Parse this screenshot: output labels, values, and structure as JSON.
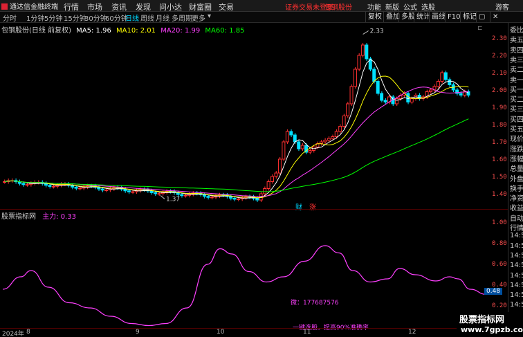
{
  "menubar": {
    "app_title": "通达信金融终端",
    "items": [
      "行情",
      "市场",
      "资讯",
      "发现",
      "问小达",
      "财富圈",
      "交易"
    ],
    "notice": "证券交易未登录",
    "account": "包钢股份",
    "right_items": [
      "功能",
      "新版",
      "公式",
      "选股",
      "游客"
    ]
  },
  "toolbar": {
    "periods": [
      "分时",
      "1分钟",
      "5分钟",
      "15分钟",
      "30分钟",
      "60分钟",
      "日线",
      "周线",
      "月线",
      "多周期",
      "更多"
    ],
    "active_period": "日线",
    "right_buttons": [
      "复权",
      "叠加",
      "多股",
      "统计",
      "画线",
      "F10",
      "标记"
    ]
  },
  "main_chart": {
    "stock_label": "包钢股份(日线 前复权)",
    "ma5_label": "MA5: 1.96",
    "ma10_label": "MA10: 2.01",
    "ma20_label": "MA20: 1.99",
    "ma60_label": "MA60: 1.85",
    "high_marker": "2.33",
    "low_marker": "1.37",
    "event_tags": [
      "财",
      "涨"
    ]
  },
  "colors": {
    "up": "#ff3030",
    "down": "#00e0ff",
    "ma5": "#ffffff",
    "ma10": "#ffff00",
    "ma20": "#ff40ff",
    "ma60": "#00ff00",
    "indicator": "#ff40ff"
  },
  "y_axis": {
    "main": [
      "2.30",
      "2.20",
      "2.10",
      "2.00",
      "1.90",
      "1.80",
      "1.70",
      "1.60",
      "1.50",
      "1.40"
    ],
    "sub": [
      "1.00",
      "0.80",
      "0.60",
      "0.40",
      "0.20"
    ],
    "sub_badge": "0.48"
  },
  "right_panel": {
    "items": [
      "委比",
      "卖五",
      "卖四",
      "卖三",
      "卖二",
      "卖一",
      "买一",
      "买二",
      "买三",
      "买四",
      "买五",
      "现价",
      "涨跌",
      "涨幅",
      "总量",
      "外盘",
      "换手",
      "净资",
      "收益",
      "自动",
      "行情",
      "14:5",
      "14:5",
      "14:5",
      "14:5",
      "14:5",
      "14:5",
      "14:5",
      "14:5",
      "14:5"
    ]
  },
  "sub_chart": {
    "name": "股票指标网",
    "value_label": "主力: 0.33",
    "ann_contact": "微：177687576",
    "ann_slogan": "一键选股，提高90%准确率"
  },
  "x_axis": {
    "labels": [
      "2024年",
      "8",
      "9",
      "10",
      "11",
      "12"
    ]
  },
  "watermark": {
    "line1": "股票指标网",
    "line2": "www.7gpzb.com"
  }
}
